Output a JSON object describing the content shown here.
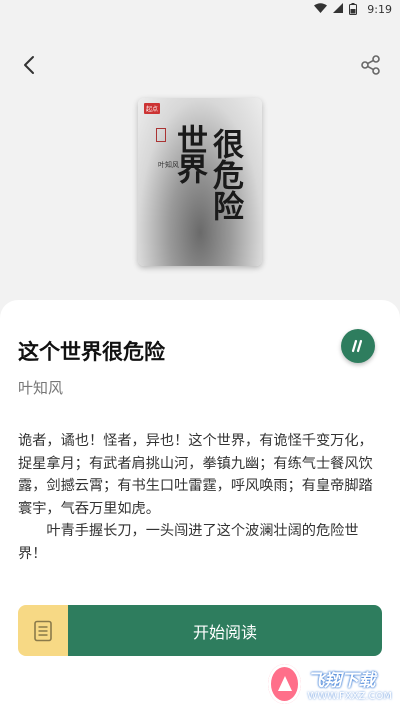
{
  "status_bar": {
    "time": "9:19",
    "battery": "8"
  },
  "cover": {
    "publisher": "起点",
    "title_line1": "很危险",
    "title_line2": "世界",
    "author_stamp": "叶知风"
  },
  "book": {
    "title": "这个世界很危险",
    "author": "叶知风",
    "description_p1": "诡者，谲也！怪者，异也！这个世界，有诡怪千变万化，捉星拿月；有武者肩挑山河，拳镇九幽；有练气士餐风饮露，剑撼云霄；有书生口吐雷霆，呼风唤雨；有皇帝脚踏寰宇，气吞万里如虎。",
    "description_p2": "叶青手握长刀，一头闯进了这个波澜壮阔的危险世界！"
  },
  "actions": {
    "start_reading": "开始阅读"
  },
  "watermark": {
    "text_cn": "飞翔下载",
    "url": "WWW.FXXZ.COM"
  },
  "colors": {
    "accent": "#2e7d5e",
    "catalog_bg": "#f7d985"
  }
}
